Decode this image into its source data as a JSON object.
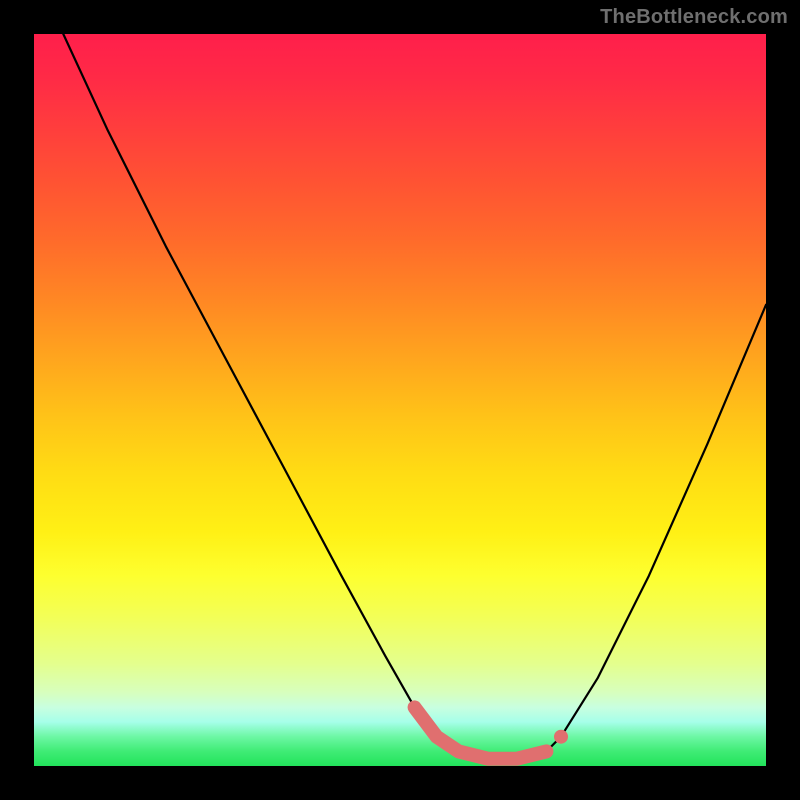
{
  "watermark": "TheBottleneck.com",
  "chart_data": {
    "type": "line",
    "title": "",
    "xlabel": "",
    "ylabel": "",
    "xlim": [
      0,
      100
    ],
    "ylim": [
      0,
      100
    ],
    "series": [
      {
        "name": "bottleneck-curve",
        "x": [
          4,
          10,
          18,
          26,
          34,
          42,
          48,
          52,
          55,
          58,
          62,
          66,
          70,
          72,
          77,
          84,
          92,
          100
        ],
        "values": [
          100,
          87,
          71,
          56,
          41,
          26,
          15,
          8,
          4,
          2,
          1,
          1,
          2,
          4,
          12,
          26,
          44,
          63
        ]
      }
    ],
    "highlight": {
      "name": "sweet-spot",
      "x": [
        52,
        55,
        58,
        62,
        66,
        70,
        71,
        72
      ],
      "values": [
        8,
        4,
        2,
        1,
        1,
        2,
        3,
        4
      ]
    },
    "colors": {
      "curve": "#000000",
      "highlight": "#e06f6f",
      "gradient_top": "#ff1f4b",
      "gradient_bottom": "#22e35b"
    }
  }
}
